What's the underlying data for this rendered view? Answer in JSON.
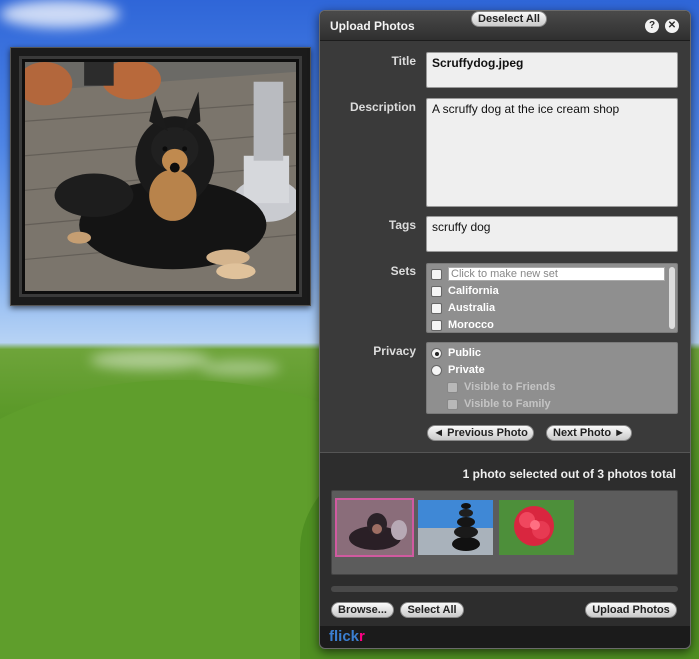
{
  "panel": {
    "title": "Upload Photos",
    "help_icon": "?",
    "close_icon": "✕"
  },
  "form": {
    "title_label": "Title",
    "title_value": "Scruffydog.jpeg",
    "description_label": "Description",
    "description_value": "A scruffy dog at the ice cream shop",
    "tags_label": "Tags",
    "tags_value": "scruffy dog",
    "sets_label": "Sets",
    "sets_new_placeholder": "Click to make new set",
    "sets": [
      "California",
      "Australia",
      "Morocco"
    ],
    "privacy_label": "Privacy",
    "privacy_options": [
      "Public",
      "Private"
    ],
    "privacy_selected": "Public",
    "private_suboptions": [
      "Visible to Friends",
      "Visible to Family"
    ]
  },
  "nav": {
    "prev_label": "◄ Previous Photo",
    "next_label": "Next Photo ►"
  },
  "selection": {
    "summary": "1 photo selected out of 3 photos total"
  },
  "actions": {
    "browse": "Browse...",
    "select_all": "Select All",
    "deselect_all": "Deselect All",
    "upload": "Upload Photos"
  },
  "footer": {
    "logo_part1": "flick",
    "logo_part2": "r"
  },
  "colors": {
    "panel_bg": "#2d2d2d",
    "selection_outline": "#d05aa0",
    "flickr_blue": "#3b7fd1",
    "flickr_pink": "#ff0084"
  }
}
